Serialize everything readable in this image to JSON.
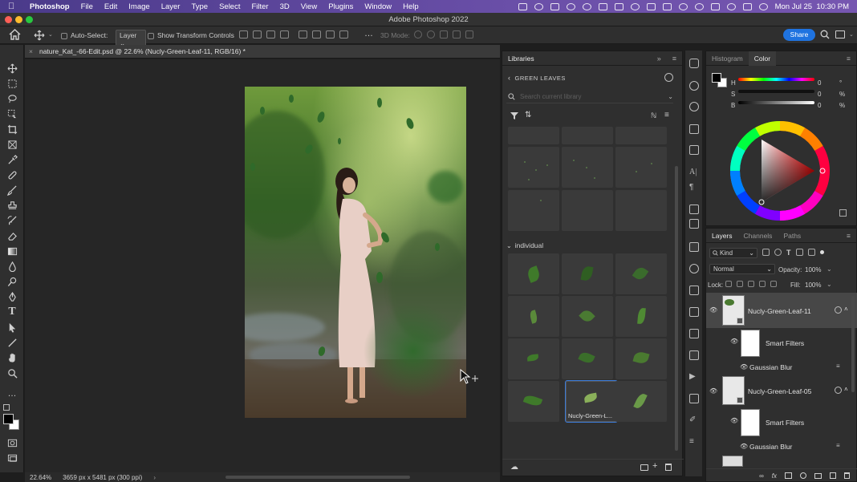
{
  "macbar": {
    "app": "Photoshop",
    "menus": [
      "File",
      "Edit",
      "Image",
      "Layer",
      "Type",
      "Select",
      "Filter",
      "3D",
      "View",
      "Plugins",
      "Window",
      "Help"
    ],
    "datetime": "Mon Jul 25  10:30 PM"
  },
  "window": {
    "title": "Adobe Photoshop 2022"
  },
  "options": {
    "auto_select_label": "Auto-Select:",
    "auto_select_value": "Layer",
    "show_transform_label": "Show Transform Controls",
    "mode3d_label": "3D Mode:",
    "share_label": "Share"
  },
  "document": {
    "tab_title": "nature_Kat_-66-Edit.psd @ 22.6% (Nucly-Green-Leaf-11, RGB/16) *",
    "zoom": "22.64%",
    "dimensions": "3659 px x 5481 px (300 ppi)"
  },
  "libraries": {
    "tab_label": "Libraries",
    "library_name": "GREEN LEAVES",
    "search_placeholder": "Search current library",
    "group_label": "individual",
    "selected_caption": "Nucly-Green-L..."
  },
  "color_panel": {
    "tabs": [
      "Histogram",
      "Color"
    ],
    "h_label": "H",
    "h_value": "0",
    "h_unit": "°",
    "s_label": "S",
    "s_value": "0",
    "s_unit": "%",
    "b_label": "B",
    "b_value": "0",
    "b_unit": "%"
  },
  "layers_panel": {
    "tabs": [
      "Layers",
      "Channels",
      "Paths"
    ],
    "filter_kind": "Kind",
    "blend_mode": "Normal",
    "opacity_label": "Opacity:",
    "opacity_value": "100%",
    "lock_label": "Lock:",
    "fill_label": "Fill:",
    "fill_value": "100%",
    "layers": [
      {
        "name": "Nucly-Green-Leaf-11",
        "filters_label": "Smart Filters",
        "filter_name": "Gaussian Blur"
      },
      {
        "name": "Nucly-Green-Leaf-05",
        "filters_label": "Smart Filters",
        "filter_name": "Gaussian Blur"
      }
    ]
  },
  "colors": {
    "accent": "#1f73e0",
    "selection": "#3b7bd8"
  }
}
